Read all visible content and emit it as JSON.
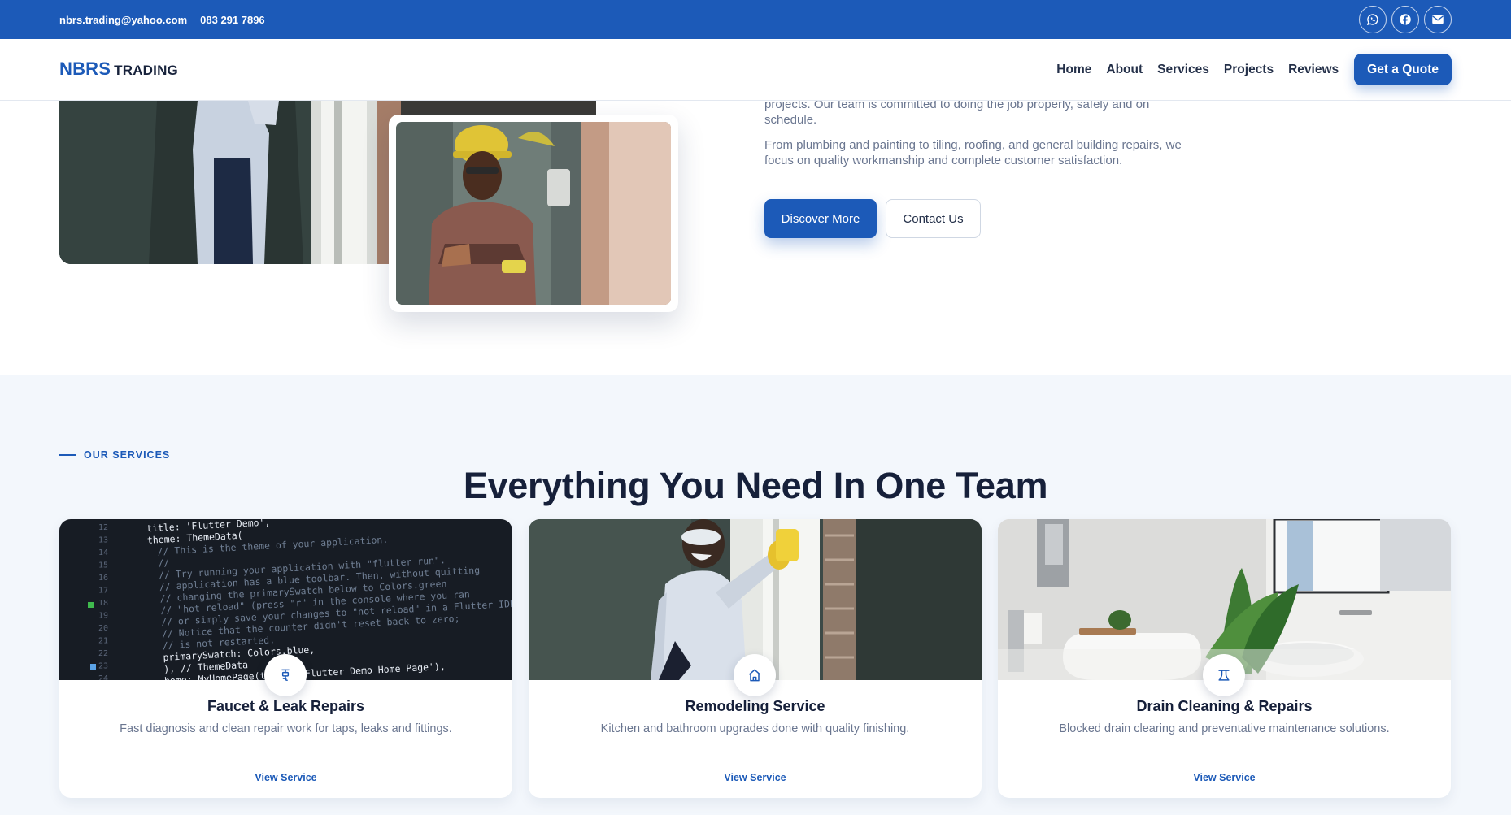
{
  "topbar": {
    "email": "nbrs.trading@yahoo.com",
    "phone": "083 291 7896",
    "socials": [
      "whatsapp-icon",
      "facebook-icon",
      "mail-icon"
    ]
  },
  "nav": {
    "logo_brand": "NBRS",
    "logo_suffix": "TRADING",
    "links": [
      "Home",
      "About",
      "Services",
      "Projects",
      "Reviews"
    ],
    "cta": "Get a Quote"
  },
  "about": {
    "paragraph1": "projects. Our team is committed to doing the job properly, safely and on schedule.",
    "paragraph2": "From plumbing and painting to tiling, roofing, and general building repairs, we focus on quality workmanship and complete customer satisfaction.",
    "primary_button": "Discover More",
    "secondary_button": "Contact Us"
  },
  "services": {
    "eyebrow": "OUR SERVICES",
    "title": "Everything You Need In One Team",
    "cards": [
      {
        "title": "Faucet & Leak Repairs",
        "description": "Fast diagnosis and clean repair work for taps, leaks and fittings.",
        "link": "View Service",
        "icon": "faucet-icon"
      },
      {
        "title": "Remodeling Service",
        "description": "Kitchen and bathroom upgrades done with quality finishing.",
        "link": "View Service",
        "icon": "home-icon"
      },
      {
        "title": "Drain Cleaning & Repairs",
        "description": "Blocked drain clearing and preventative maintenance solutions.",
        "link": "View Service",
        "icon": "drain-icon"
      }
    ]
  },
  "code_lines": [
    "title: 'Flutter Demo',",
    "theme: ThemeData(",
    "  // This is the theme of your application.",
    "  //",
    "  // Try running your application with \"flutter run\".",
    "  // application has a blue toolbar. Then, without quitting",
    "  // changing the primarySwatch below to Colors.green",
    "  // \"hot reload\" (press \"r\" in the console where you ran",
    "  // or simply save your changes to \"hot reload\" in a Flutter IDE",
    "  // Notice that the counter didn't reset back to zero;",
    "  // is not restarted.",
    "  primarySwatch: Colors.blue,",
    "), // ThemeData",
    "home: MyHomePage(title: 'Flutter Demo Home Page'),"
  ],
  "code_line_numbers": [
    "12",
    "13",
    "14",
    "15",
    "16",
    "17",
    "18",
    "19",
    "20",
    "21",
    "22",
    "23",
    "24"
  ],
  "colors": {
    "primary": "#1c5ab8",
    "dark_text": "#16203a",
    "muted_text": "#6a7690",
    "section_bg": "#f3f7fc"
  }
}
